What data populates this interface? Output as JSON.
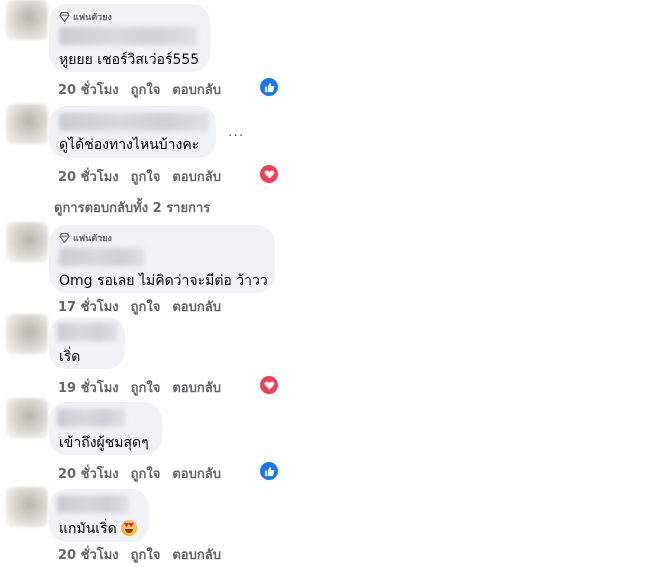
{
  "comments": [
    {
      "badge": "แฟนตัวยง",
      "text": "หูยยย เชอร์วิสเว่อร์555",
      "time": "20 ชั่วโมง",
      "like": "ถูกใจ",
      "reply": "ตอบกลับ",
      "reaction": "like-icon"
    },
    {
      "text": "ดูได้ช่องทางไหนบ้างคะ",
      "time": "20 ชั่วโมง",
      "like": "ถูกใจ",
      "reply": "ตอบกลับ",
      "reaction": "love-icon",
      "more": "..."
    },
    {
      "badge": "แฟนตัวยง",
      "text": "Omg รอเลย ไม่คิดว่าจะมีต่อ ว้าวว",
      "time": "17 ชั่วโมง",
      "like": "ถูกใจ",
      "reply": "ตอบกลับ"
    },
    {
      "text": "เริ่ด",
      "time": "19 ชั่วโมง",
      "like": "ถูกใจ",
      "reply": "ตอบกลับ",
      "reaction": "love-icon"
    },
    {
      "text": "เข้าถึงผู้ชมสุดๆ",
      "time": "20 ชั่วโมง",
      "like": "ถูกใจ",
      "reply": "ตอบกลับ",
      "reaction": "like-icon"
    },
    {
      "text": "แกมันเริ่ด",
      "emoji": "heart-eyes-emoji",
      "time": "20 ชั่วโมง",
      "like": "ถูกใจ",
      "reply": "ตอบกลับ"
    }
  ],
  "view_replies": "ดูการตอบกลับทั้ง 2 รายการ",
  "colors": {
    "bubble": "#f0f2f5",
    "meta": "#65676b",
    "like": "#1877f2",
    "love": "#f33e58"
  }
}
